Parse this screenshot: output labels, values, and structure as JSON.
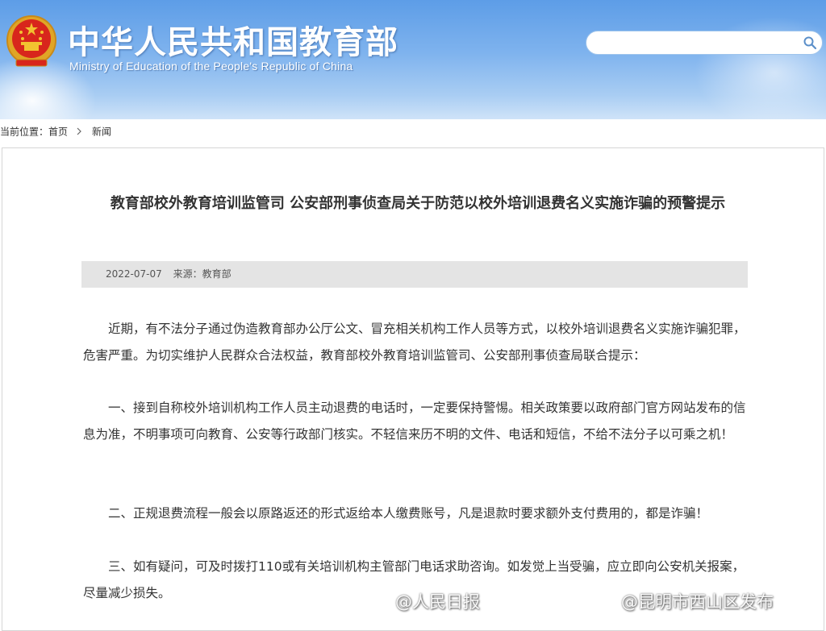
{
  "header": {
    "title": "中华人民共和国教育部",
    "subtitle": "Ministry of Education of the People's Republic of China",
    "search": {
      "value": "",
      "placeholder": ""
    }
  },
  "breadcrumb": {
    "label": "当前位置：",
    "items": [
      "首页",
      "新闻"
    ]
  },
  "article": {
    "title": "教育部校外教育培训监管司 公安部刑事侦查局关于防范以校外培训退费名义实施诈骗的预警提示",
    "date": "2022-07-07",
    "source": "来源：教育部",
    "paragraphs": [
      "近期，有不法分子通过伪造教育部办公厅公文、冒充相关机构工作人员等方式，以校外培训退费名义实施诈骗犯罪，危害严重。为切实维护人民群众合法权益，教育部校外教育培训监管司、公安部刑事侦查局联合提示：",
      "一、接到自称校外培训机构工作人员主动退费的电话时，一定要保持警惕。相关政策要以政府部门官方网站发布的信息为准，不明事项可向教育、公安等行政部门核实。不轻信来历不明的文件、电话和短信，不给不法分子以可乘之机！",
      "二、正规退费流程一般会以原路返还的形式返给本人缴费账号，凡是退款时要求额外支付费用的，都是诈骗！",
      "三、如有疑问，可及时拨打110或有关培训机构主管部门电话求助咨询。如发觉上当受骗，应立即向公安机关报案，尽量减少损失。"
    ]
  },
  "watermarks": [
    "@人民日报",
    "@昆明市西山区发布"
  ],
  "colors": {
    "header_top": "#5d9de7",
    "header_bottom": "#cfe3f8",
    "meta_bar": "#e4e4e4",
    "emblem_red": "#d8261c",
    "emblem_gold": "#f2c230"
  },
  "icons": {
    "emblem": "national-emblem-icon",
    "search": "search-icon",
    "separator": "chevron-right-icon",
    "watermark_logo": "weibo-icon"
  }
}
